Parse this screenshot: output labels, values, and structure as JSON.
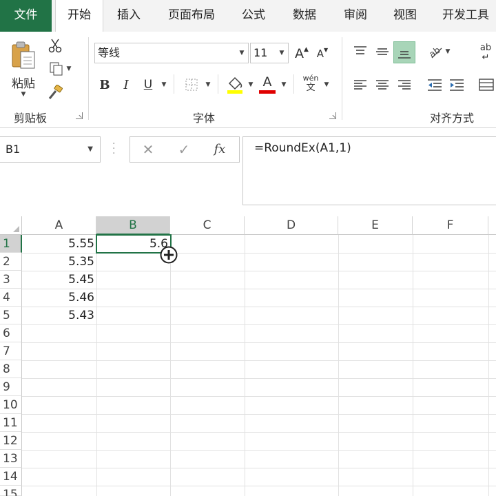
{
  "tabs": [
    {
      "label": "文件"
    },
    {
      "label": "开始"
    },
    {
      "label": "插入"
    },
    {
      "label": "页面布局"
    },
    {
      "label": "公式"
    },
    {
      "label": "数据"
    },
    {
      "label": "审阅"
    },
    {
      "label": "视图"
    },
    {
      "label": "开发工具"
    }
  ],
  "ribbon": {
    "clipboard": {
      "paste_label": "粘贴",
      "group_label": "剪贴板"
    },
    "font": {
      "font_name": "等线",
      "font_size": "11",
      "grow_font": "A",
      "shrink_font": "A",
      "bold": "B",
      "italic": "I",
      "underline": "U",
      "font_color_letter": "A",
      "phonetic_top": "wén",
      "phonetic_bottom": "文",
      "group_label": "字体"
    },
    "alignment": {
      "wrap_text": "ab",
      "group_label": "对齐方式"
    }
  },
  "formula_bar": {
    "name_box": "B1",
    "cancel": "✕",
    "enter": "✓",
    "fx": "fx",
    "formula": "=RoundEx(A1,1)"
  },
  "grid": {
    "columns": [
      "A",
      "B",
      "C",
      "D",
      "E",
      "F"
    ],
    "rows": [
      "1",
      "2",
      "3",
      "4",
      "5",
      "6",
      "7",
      "8",
      "9",
      "10",
      "11",
      "12",
      "13",
      "14",
      "15"
    ],
    "selected_cell": "B1",
    "column_a_values": [
      "5.55",
      "5.35",
      "5.45",
      "5.46",
      "5.43"
    ],
    "b1_value": "5.6"
  },
  "colors": {
    "accent": "#217346",
    "font_color_bar": "#e00000",
    "highlight_bar": "#ffff00"
  }
}
